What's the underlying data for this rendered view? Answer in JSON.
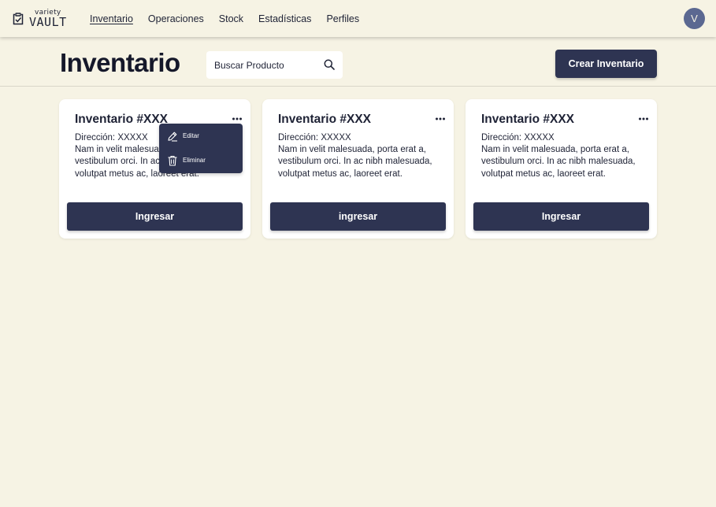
{
  "brand": {
    "small": "variety",
    "big": "VAULT"
  },
  "nav": {
    "items": [
      {
        "label": "Inventario",
        "active": true
      },
      {
        "label": "Operaciones",
        "active": false
      },
      {
        "label": "Stock",
        "active": false
      },
      {
        "label": "Estadísticas",
        "active": false
      },
      {
        "label": "Perfiles",
        "active": false
      }
    ]
  },
  "user": {
    "avatar_initial": "V"
  },
  "header": {
    "title": "Inventario",
    "search_placeholder": "Buscar Producto",
    "create_label": "Crear Inventario"
  },
  "cards": [
    {
      "title": "Inventario #XXX",
      "address": "Dirección: XXXXX",
      "description": "Nam in velit malesuada, porta erat a, vestibulum orci. In ac nibh malesuada, volutpat metus ac, laoreet erat.",
      "button": "Ingresar"
    },
    {
      "title": "Inventario #XXX",
      "address": "Dirección: XXXXX",
      "description": "Nam in velit malesuada, porta erat a, vestibulum orci. In ac nibh malesuada, volutpat metus ac, laoreet erat.",
      "button": "ingresar"
    },
    {
      "title": "Inventario #XXX",
      "address": "Dirección: XXXXX",
      "description": "Nam in velit malesuada, porta erat a, vestibulum orci. In ac nibh malesuada, volutpat metus ac, laoreet erat.",
      "button": "Ingresar"
    }
  ],
  "context_menu": {
    "items": [
      {
        "label": "Editar",
        "icon": "pencil-icon"
      },
      {
        "label": "Eliminar",
        "icon": "trash-icon"
      }
    ]
  },
  "colors": {
    "background": "#f6f3e4",
    "primary": "#2e3452",
    "avatar": "#5b6891",
    "card": "#ffffff"
  }
}
